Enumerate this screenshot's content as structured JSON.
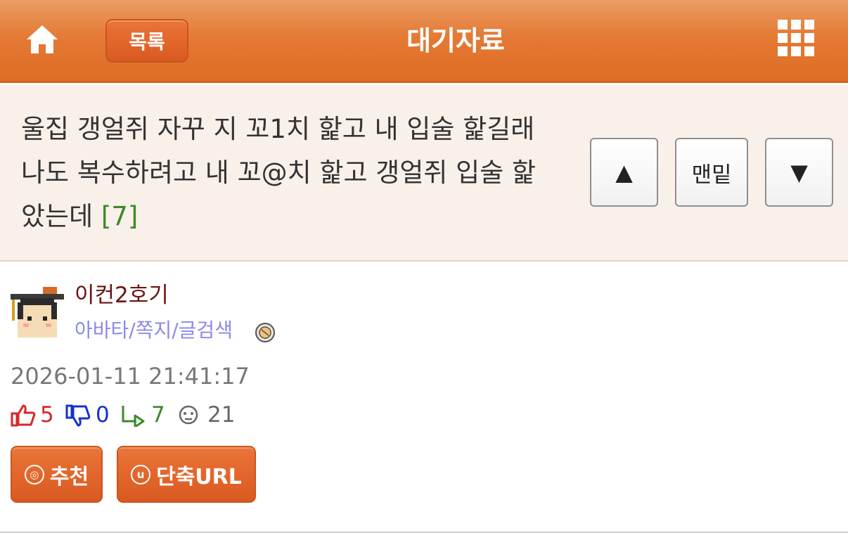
{
  "header": {
    "home_icon": "home-icon",
    "list_label": "목록",
    "title": "대기자료",
    "menu_icon": "grid-menu-icon"
  },
  "post": {
    "title": "울집 갱얼쥐 자꾸 지 꼬1치 핥고 내 입술 핥길래 나도 복수하려고 내 꼬@치 핥고 갱얼쥐 입술 핥았는데",
    "comment_count": "[7]"
  },
  "nav": {
    "up_label": "▲",
    "bottom_label": "맨밑",
    "down_label": "▼"
  },
  "author": {
    "name": "이컨2호기",
    "links": "아바타/쪽지/글검색",
    "avatar_icon": "graduate-avatar",
    "medal_icon": "medal-icon"
  },
  "meta": {
    "date": "2026-01-11 21:41:17",
    "upvotes": "5",
    "downvotes": "0",
    "replies": "7",
    "views": "21"
  },
  "actions": {
    "recommend_label": "추천",
    "shorturl_label": "단축URL"
  },
  "colors": {
    "header_orange": "#e47a35",
    "title_bg": "#faf0ea",
    "author_name": "#6b1313",
    "author_links": "#8b8be8",
    "upvote": "#d62828",
    "downvote": "#1630d1",
    "reply": "#3d8a2a"
  }
}
